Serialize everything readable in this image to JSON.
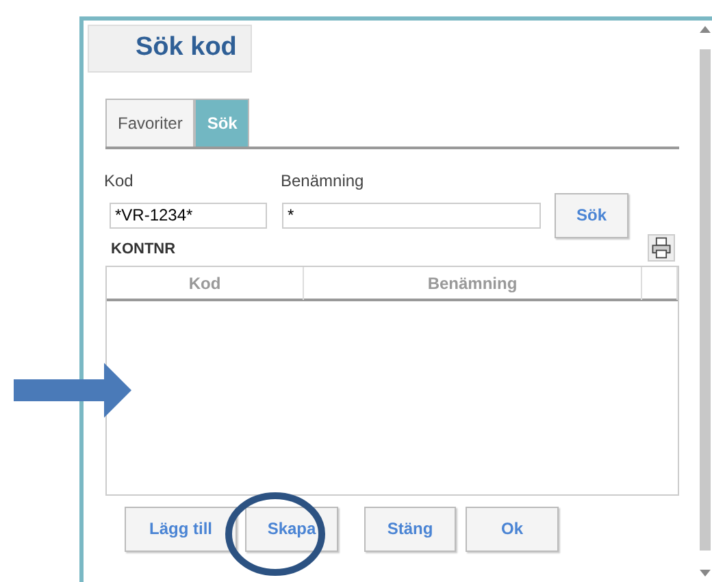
{
  "dialog": {
    "title": "Sök kod"
  },
  "tabs": [
    {
      "label": "Favoriter",
      "selected": false
    },
    {
      "label": "Sök",
      "selected": true
    }
  ],
  "fields": [
    {
      "label": "Kod",
      "value": "*VR-1234*"
    },
    {
      "label": "Benämning",
      "value": "*"
    }
  ],
  "search_button": "Sök",
  "section": "KONTNR",
  "table": {
    "columns": [
      "Kod",
      "Benämning"
    ]
  },
  "buttons": [
    "Lägg till",
    "Skapa",
    "Stäng",
    "Ok"
  ],
  "annotations": [
    {
      "kind": "arrow"
    },
    {
      "kind": "circle"
    }
  ]
}
